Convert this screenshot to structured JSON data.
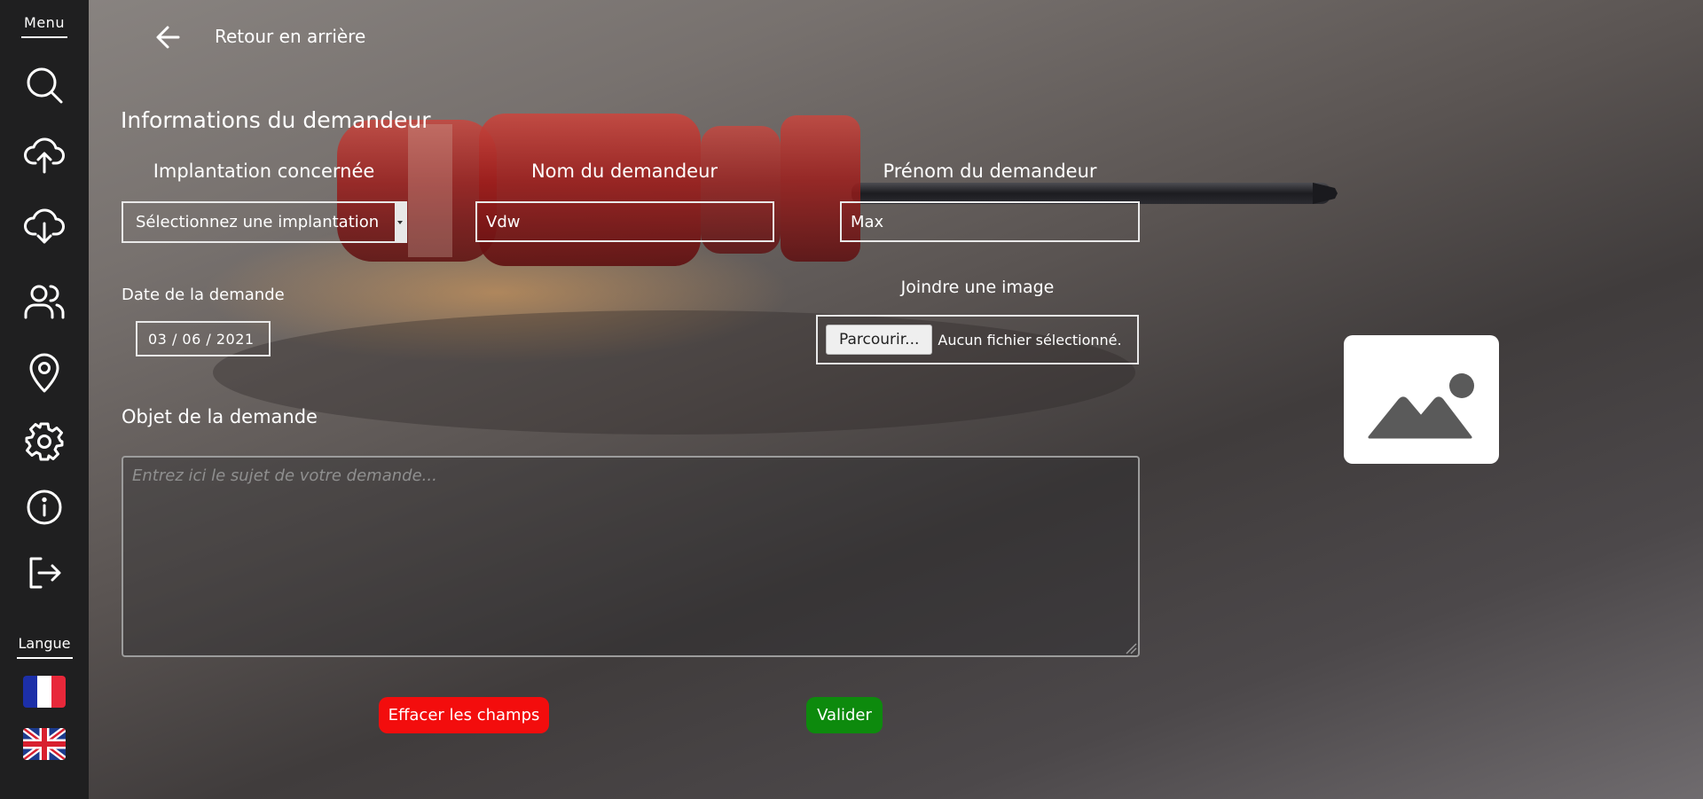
{
  "sidebar": {
    "menu_title": "Menu",
    "icons": [
      "search-icon",
      "upload-cloud-icon",
      "download-cloud-icon",
      "users-icon",
      "map-pin-icon",
      "settings-gear-icon",
      "info-icon",
      "logout-icon"
    ],
    "language_title": "Langue",
    "languages": [
      "flag-france-icon",
      "flag-uk-icon"
    ]
  },
  "header": {
    "back_label": "Retour en arrière"
  },
  "form": {
    "section_title": "Informations du demandeur",
    "implantation_label": "Implantation concernée",
    "implantation_value": "Sélectionnez une implantation",
    "nom_label": "Nom du demandeur",
    "nom_value": "Vdw",
    "prenom_label": "Prénom du demandeur",
    "prenom_value": "Max",
    "date_label": "Date de la demande",
    "date_value": "03 / 06 / 2021",
    "image_label": "Joindre une image",
    "file_button": "Parcourir...",
    "file_status": "Aucun fichier sélectionné.",
    "objet_label": "Objet de la demande",
    "objet_placeholder": "Entrez ici le sujet de votre demande...",
    "clear_button": "Effacer les champs",
    "submit_button": "Valider"
  },
  "colors": {
    "sidebar_bg": "#1f1f20",
    "clear_button": "#f30d0d",
    "submit_button": "#0d8a0d"
  }
}
